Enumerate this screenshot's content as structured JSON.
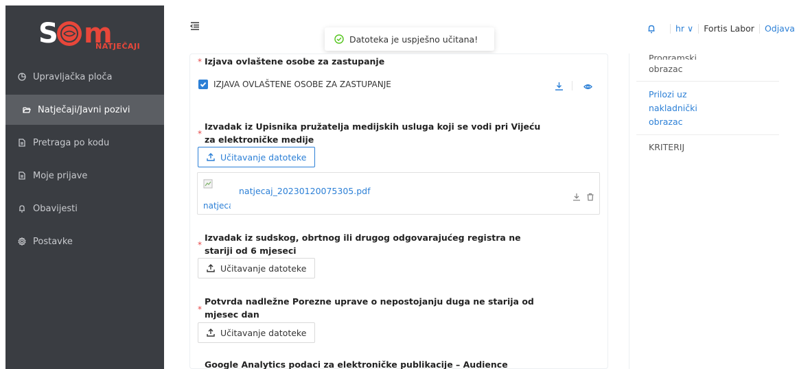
{
  "app": {
    "logo_text": "S☺m",
    "logo_sub": "NATJEČAJI"
  },
  "sidebar": {
    "items": [
      {
        "label": "Upravljačka ploča",
        "icon": "dashboard-icon"
      },
      {
        "label": "Natječaji/Javni pozivi",
        "icon": "folder-open-icon",
        "active": true
      },
      {
        "label": "Pretraga po kodu",
        "icon": "document-icon"
      },
      {
        "label": "Moje prijave",
        "icon": "document-icon"
      },
      {
        "label": "Obavijesti",
        "icon": "bell-icon"
      },
      {
        "label": "Postavke",
        "icon": "gear-icon"
      }
    ]
  },
  "toast": {
    "message": "Datoteka je uspješno učitana!",
    "icon": "check-circle-icon",
    "color": "#52c41a"
  },
  "header": {
    "lang": "hr ∨",
    "user": "Fortis Labor",
    "logout": "Odjava"
  },
  "form": {
    "field1": {
      "label": "Izjava ovlaštene osobe za zastupanje",
      "checkbox_label": "IZJAVA OVLAŠTENE OSOBE ZA ZASTUPANJE"
    },
    "field2": {
      "label_line1": "Izvadak iz Upisnika pružatelja medijskih usluga koji se vodi pri Vijeću",
      "label_line2": "za elektroničke medije",
      "upload_label": "Učitavanje datoteke",
      "file_name": "natjecaj_20230120075305.pdf",
      "thumb_text": "natjecaj"
    },
    "field3": {
      "label_line1": "Izvadak iz sudskog, obrtnog ili drugog odgovarajućeg registra ne",
      "label_line2": "stariji od 6 mjeseci",
      "upload_label": "Učitavanje datoteke"
    },
    "field4": {
      "label_line1": "Potvrda nadležne Porezne uprave o nepostojanju duga ne starija od",
      "label_line2": "mjesec dan",
      "upload_label": "Učitavanje datoteke"
    },
    "field5": {
      "label_line1": "Google Analytics podaci za elektroničke publikacije – Audience"
    }
  },
  "side_panel": {
    "item_partial": "Programski",
    "item_partial2": "obrazac",
    "item_link_line1": "Prilozi uz",
    "item_link_line2": "nakladnički",
    "item_link_line3": "obrazac",
    "item_plain": "KRITERIJ"
  },
  "colors": {
    "sidebar": "#3a3d42",
    "accent": "#2b7fd6",
    "required": "#e64a4a",
    "logo": "#e8473a"
  }
}
